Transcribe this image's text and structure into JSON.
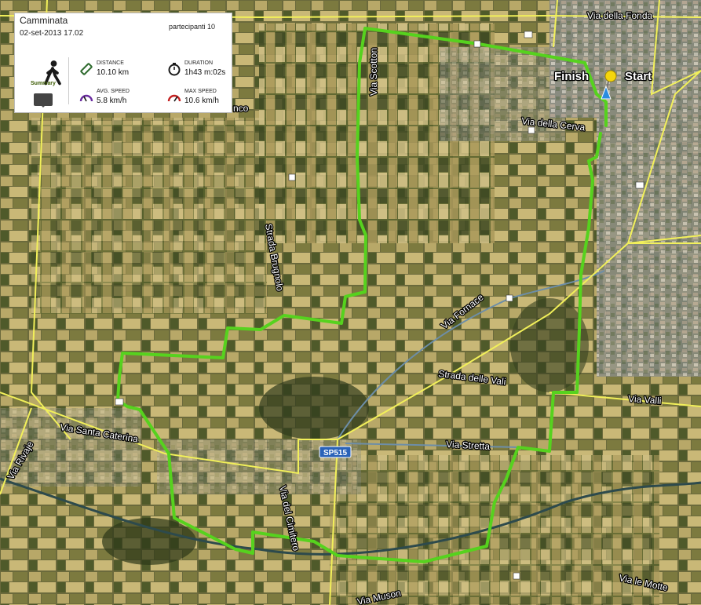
{
  "panel": {
    "title": "Camminata",
    "date": "02-set-2013  17.02",
    "participants": "partecipanti 10",
    "summary_label": "Summary",
    "stats": {
      "distance_label": "DISTANCE",
      "distance_value": "10.10  km",
      "duration_label": "DURATION",
      "duration_value": "1h43  m:02s",
      "avg_speed_label": "AVG. SPEED",
      "avg_speed_value": "5.8  km/h",
      "max_speed_label": "MAX SPEED",
      "max_speed_value": "10.6 km/h"
    }
  },
  "map": {
    "route_color": "#56d21e",
    "road_color": "#f2f05a",
    "start_label": "Start",
    "finish_label": "Finish",
    "road_shield": "SP515",
    "labels": {
      "via_della_fonda": "Via della Fonda",
      "via_scotton": "Via Scotton",
      "via_della_cerva": "Via della Cerva",
      "strada_brugnolo": "Strada Brugnolo",
      "via_fornace": "Via Fornace",
      "strada_delle_vali": "Strada delle Vali",
      "via_valli": "Via Valli",
      "via_santa_caterina": "Via Santa Caterina",
      "via_rivaje": "Via Rivaje",
      "via_stretta": "Via Stretta",
      "via_del_cimitero": "Via del Cimitero",
      "via_le_motte": "Via le Motte",
      "via_muson": "Via Muson",
      "nco_fragment": "nco"
    }
  }
}
